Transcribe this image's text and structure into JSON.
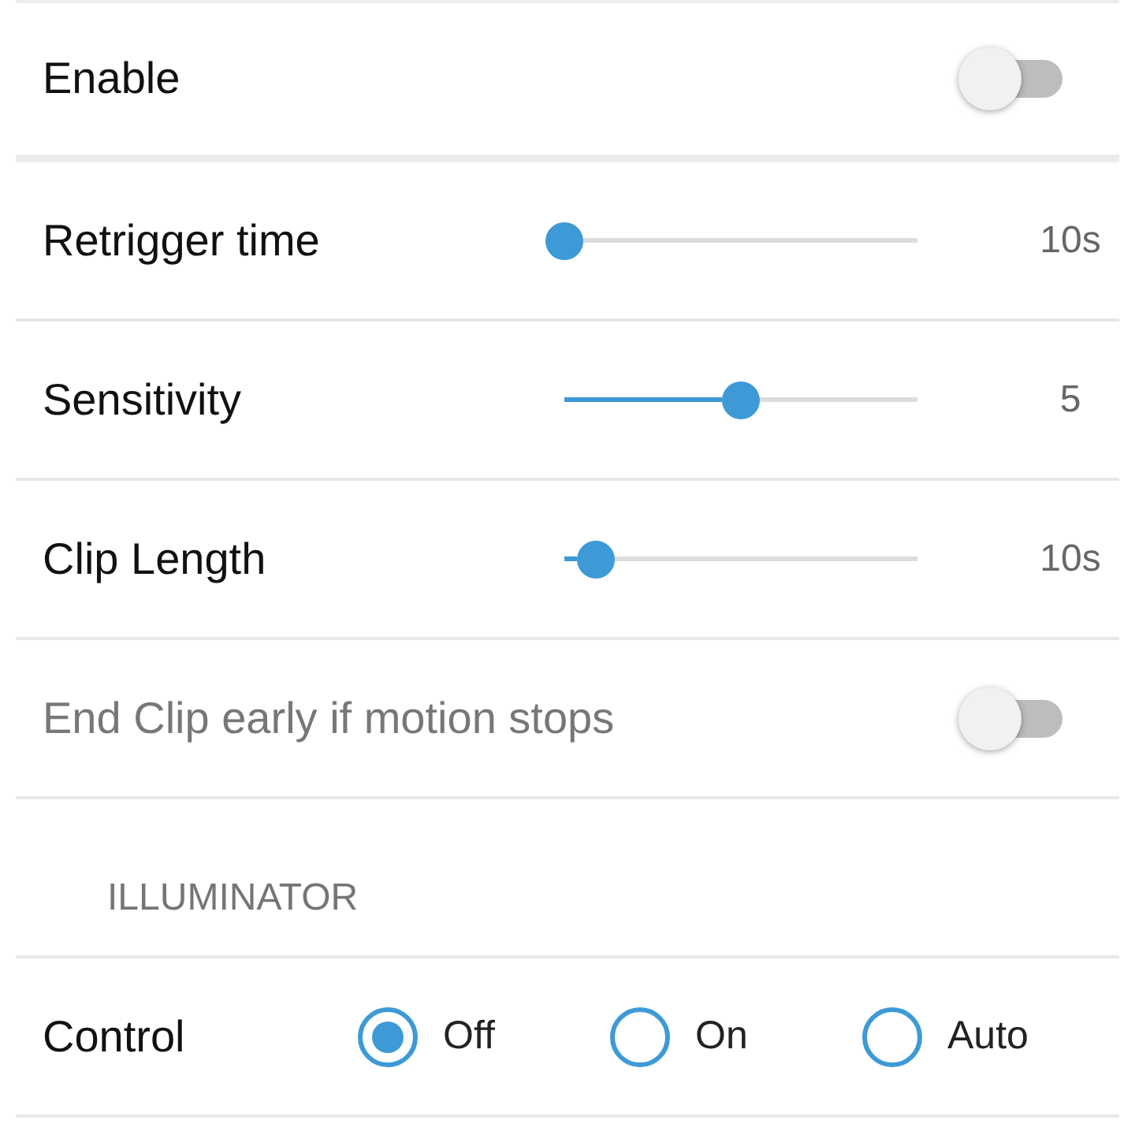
{
  "settings": [
    {
      "kind": "toggle",
      "label": "Enable",
      "on": false,
      "disabled": false
    },
    {
      "kind": "slider",
      "label": "Retrigger time",
      "level": 0,
      "reading": "10s"
    },
    {
      "kind": "slider",
      "label": "Sensitivity",
      "level": 0.5,
      "reading": "5"
    },
    {
      "kind": "slider",
      "label": "Clip Length",
      "level": 0.09,
      "reading": "10s"
    },
    {
      "kind": "toggle",
      "label": "End Clip early if motion stops",
      "on": false,
      "disabled": true
    }
  ],
  "illuminator": {
    "header": "ILLUMINATOR",
    "control": {
      "label": "Control",
      "options": [
        {
          "label": "Off",
          "selected": true
        },
        {
          "label": "On",
          "selected": false
        },
        {
          "label": "Auto",
          "selected": false
        }
      ]
    }
  }
}
